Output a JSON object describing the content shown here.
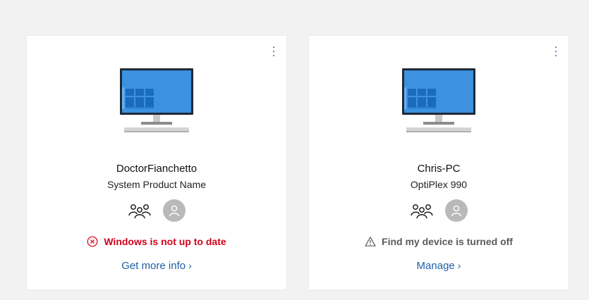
{
  "cards": [
    {
      "device_name": "DoctorFianchetto",
      "device_model": "System Product Name",
      "status": {
        "type": "error",
        "icon": "error-circle-icon",
        "text": "Windows is not up to date",
        "color": "#d0021b"
      },
      "action": {
        "label": "Get more info",
        "chevron": "›"
      }
    },
    {
      "device_name": "Chris-PC",
      "device_model": "OptiPlex 990",
      "status": {
        "type": "warning",
        "icon": "warning-triangle-icon",
        "text": "Find my device is turned off",
        "color": "#5a5a5a"
      },
      "action": {
        "label": "Manage",
        "chevron": "›"
      }
    }
  ],
  "colors": {
    "accent": "#1f5fa6",
    "monitor_screen": "#3c92de",
    "monitor_frame": "#1f2a35",
    "avatar_bg": "#b9b9b9"
  }
}
